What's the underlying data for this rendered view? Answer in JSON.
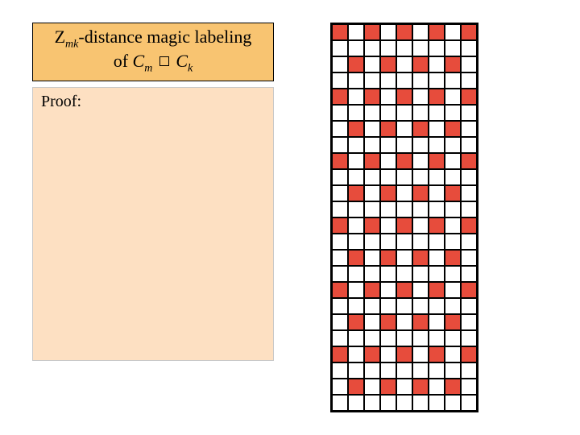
{
  "title": {
    "z": "Z",
    "sub1": "mk",
    "rest1": "-distance magic labeling",
    "of": "of ",
    "c1": "C",
    "sub2": "m",
    "c2": "C",
    "sub3": "k"
  },
  "proof": {
    "label": "Proof:"
  },
  "chart_data": {
    "type": "heatmap",
    "title": "",
    "xlabel": "",
    "ylabel": "",
    "cols": 9,
    "rows": 24,
    "cell_size": 20,
    "colors": {
      "0": "#ffffff",
      "1": "#e74c3c"
    },
    "values": [
      [
        1,
        0,
        1,
        0,
        1,
        0,
        1,
        0,
        1
      ],
      [
        0,
        0,
        0,
        0,
        0,
        0,
        0,
        0,
        0
      ],
      [
        0,
        1,
        0,
        1,
        0,
        1,
        0,
        1,
        0
      ],
      [
        0,
        0,
        0,
        0,
        0,
        0,
        0,
        0,
        0
      ],
      [
        1,
        0,
        1,
        0,
        1,
        0,
        1,
        0,
        1
      ],
      [
        0,
        0,
        0,
        0,
        0,
        0,
        0,
        0,
        0
      ],
      [
        0,
        1,
        0,
        1,
        0,
        1,
        0,
        1,
        0
      ],
      [
        0,
        0,
        0,
        0,
        0,
        0,
        0,
        0,
        0
      ],
      [
        1,
        0,
        1,
        0,
        1,
        0,
        1,
        0,
        1
      ],
      [
        0,
        0,
        0,
        0,
        0,
        0,
        0,
        0,
        0
      ],
      [
        0,
        1,
        0,
        1,
        0,
        1,
        0,
        1,
        0
      ],
      [
        0,
        0,
        0,
        0,
        0,
        0,
        0,
        0,
        0
      ],
      [
        1,
        0,
        1,
        0,
        1,
        0,
        1,
        0,
        1
      ],
      [
        0,
        0,
        0,
        0,
        0,
        0,
        0,
        0,
        0
      ],
      [
        0,
        1,
        0,
        1,
        0,
        1,
        0,
        1,
        0
      ],
      [
        0,
        0,
        0,
        0,
        0,
        0,
        0,
        0,
        0
      ],
      [
        1,
        0,
        1,
        0,
        1,
        0,
        1,
        0,
        1
      ],
      [
        0,
        0,
        0,
        0,
        0,
        0,
        0,
        0,
        0
      ],
      [
        0,
        1,
        0,
        1,
        0,
        1,
        0,
        1,
        0
      ],
      [
        0,
        0,
        0,
        0,
        0,
        0,
        0,
        0,
        0
      ],
      [
        1,
        0,
        1,
        0,
        1,
        0,
        1,
        0,
        1
      ],
      [
        0,
        0,
        0,
        0,
        0,
        0,
        0,
        0,
        0
      ],
      [
        0,
        1,
        0,
        1,
        0,
        1,
        0,
        1,
        0
      ],
      [
        0,
        0,
        0,
        0,
        0,
        0,
        0,
        0,
        0
      ]
    ]
  }
}
